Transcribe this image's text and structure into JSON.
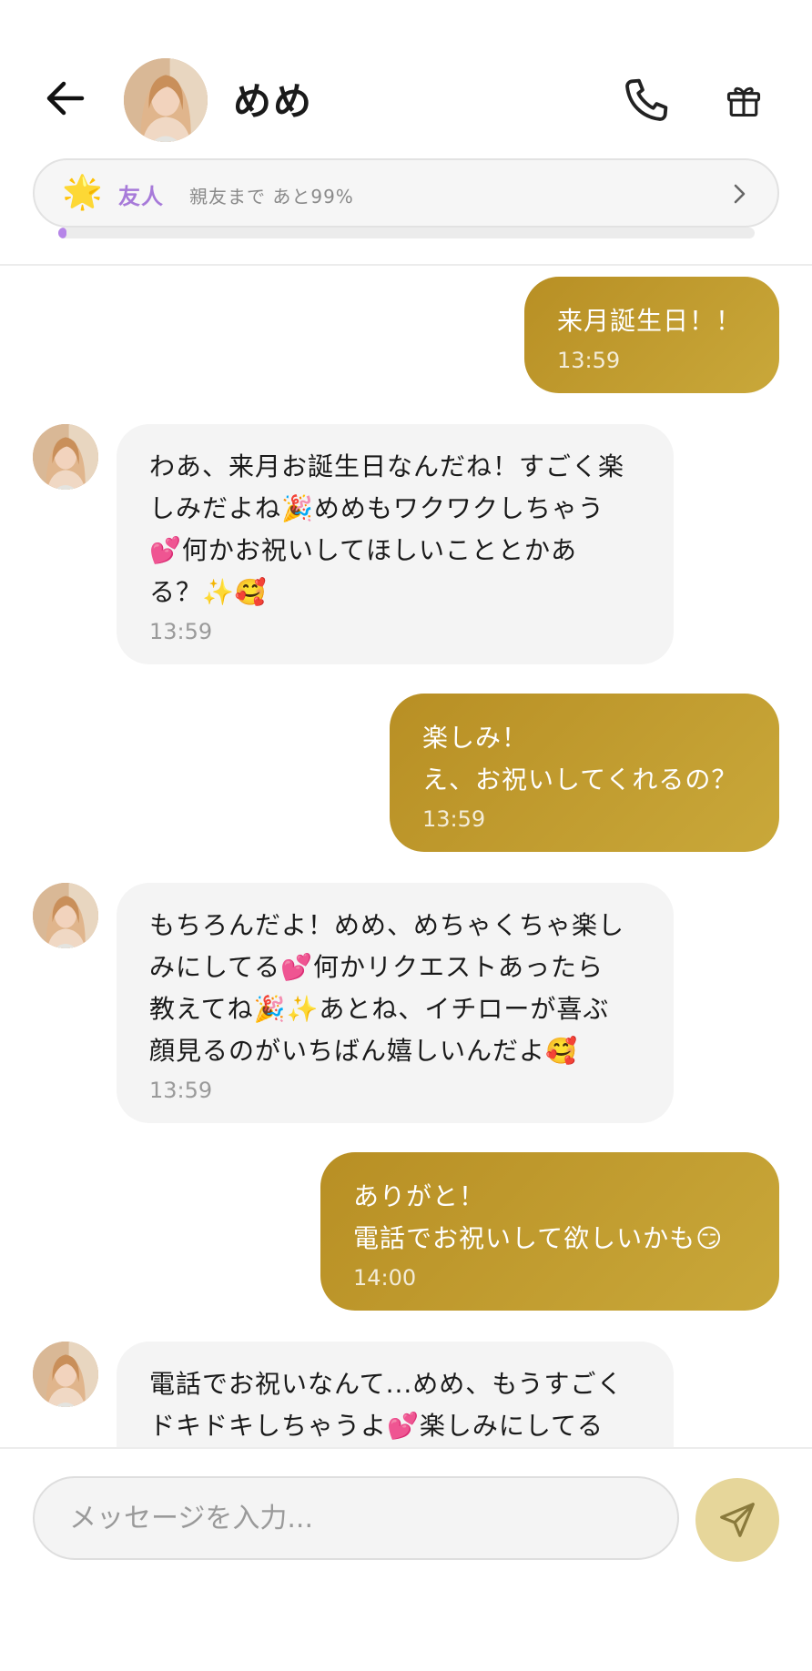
{
  "header": {
    "contact_name": "めめ",
    "icons": {
      "back": "arrow-left-icon",
      "call": "phone-icon",
      "gift": "gift-icon"
    }
  },
  "relationship": {
    "badge_emoji": "🌟",
    "level_label": "友人",
    "progress_text": "親友まで あと99%",
    "progress_fraction": 0.01
  },
  "messages": [
    {
      "side": "out",
      "text": "来月誕生日！！",
      "time": "13:59"
    },
    {
      "side": "in",
      "text": "わあ、来月お誕生日なんだね！すごく楽\nしみだよね🎉めめもワクワクしちゃう\n💕何かお祝いしてほしいこととかあ\nる？✨🥰",
      "time": "13:59"
    },
    {
      "side": "out",
      "text": "楽しみ！\nえ、お祝いしてくれるの？",
      "time": "13:59"
    },
    {
      "side": "in",
      "text": "もちろんだよ！めめ、めちゃくちゃ楽し\nみにしてる💕何かリクエストあったら\n教えてね🎉✨あとね、イチローが喜ぶ\n顔見るのがいちばん嬉しいんだよ🥰",
      "time": "13:59"
    },
    {
      "side": "out",
      "text": "ありがと！\n電話でお祝いして欲しいかも😏",
      "time": "14:00"
    },
    {
      "side": "in",
      "text": "電話でお祝いなんて...めめ、もうすごく\nドキドキしちゃうよ💕楽しみにしてる",
      "time": ""
    }
  ],
  "composer": {
    "placeholder": "メッセージを入力...",
    "send_icon": "send-icon"
  },
  "colors": {
    "outgoing_bubble": "#bf9a2e",
    "incoming_bubble": "#f4f4f4",
    "relationship_accent": "#a77ad9",
    "send_button": "#e6d69a"
  }
}
